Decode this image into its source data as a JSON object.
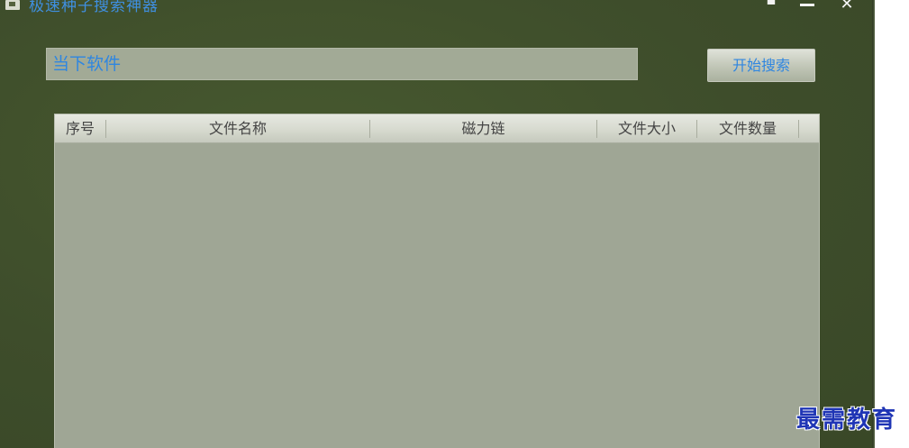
{
  "window": {
    "title": "极速种子搜索神器",
    "skin_icon": "shirt-icon",
    "minimize_icon": "minimize-icon",
    "close_label": "✕"
  },
  "search": {
    "placeholder": "当下软件",
    "value": "",
    "button_label": "开始搜索"
  },
  "table": {
    "columns": [
      "序号",
      "文件名称",
      "磁力链",
      "文件大小",
      "文件数量"
    ],
    "rows": []
  },
  "watermark": "最需教育",
  "colors": {
    "window_background": "#3e4d2b",
    "accent_text": "#2f86e0",
    "table_background": "#9fa695"
  }
}
